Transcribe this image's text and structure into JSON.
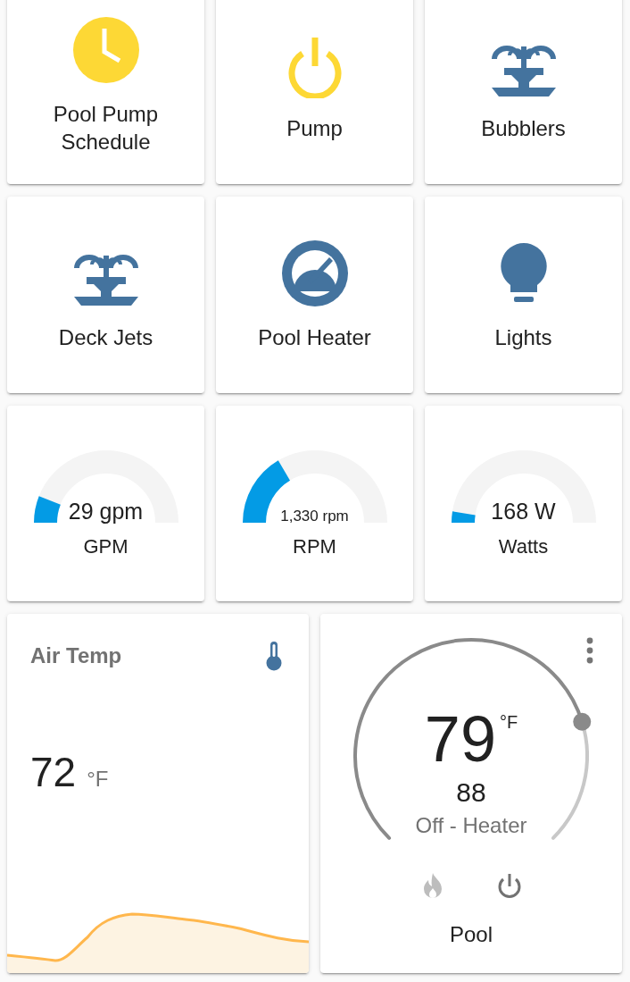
{
  "tiles": [
    {
      "kind": "button",
      "name": "Pool Pump Schedule",
      "on": true
    },
    {
      "kind": "button",
      "name": "Pump",
      "on": true
    },
    {
      "kind": "button",
      "name": "Bubblers",
      "on": false
    },
    {
      "kind": "button",
      "name": "Deck Jets",
      "on": false
    },
    {
      "kind": "button",
      "name": "Pool Heater",
      "on": false
    },
    {
      "kind": "button",
      "name": "Lights",
      "on": false
    },
    {
      "kind": "gauge",
      "value": "29 gpm",
      "name": "GPM"
    },
    {
      "kind": "gauge",
      "value": "1,330 rpm",
      "name": "RPM"
    },
    {
      "kind": "gauge",
      "value": "168 W",
      "name": "Watts"
    }
  ],
  "sensor": {
    "title": "Air Temp",
    "value": "72",
    "unit": "°F"
  },
  "thermostat": {
    "current": "79",
    "unit": "°F",
    "target": "88",
    "status": "Off - Heater",
    "name": "Pool",
    "modes": [
      {
        "kind": "heat",
        "selected": false
      },
      {
        "kind": "off",
        "selected": true
      }
    ]
  }
}
